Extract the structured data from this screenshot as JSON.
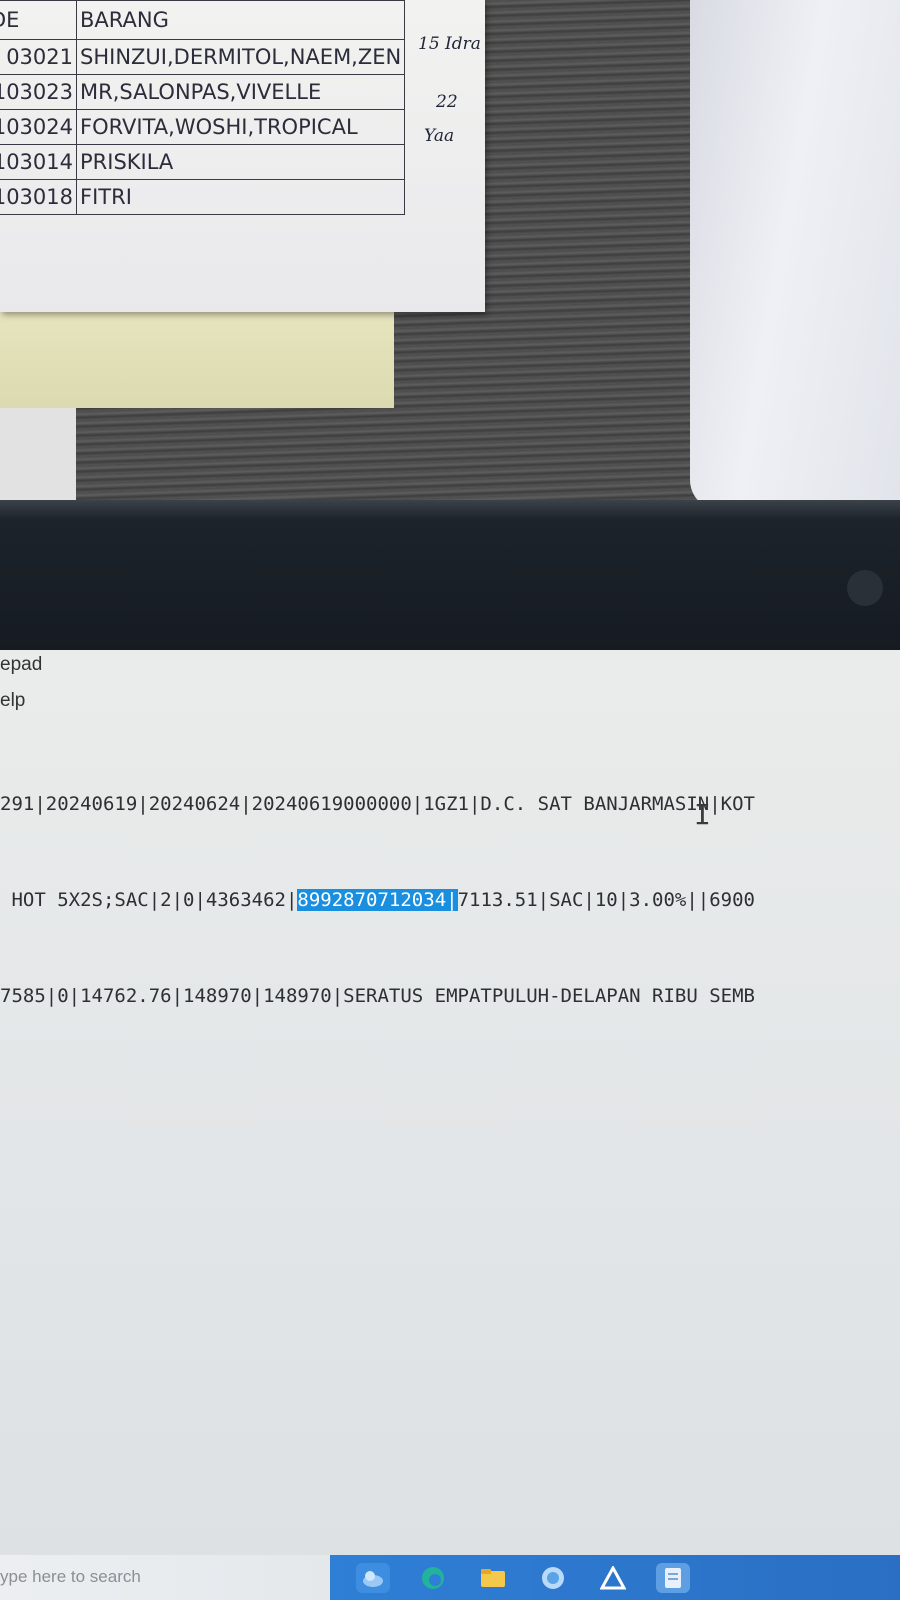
{
  "paper_note": {
    "header": [
      "DE",
      "BARANG"
    ],
    "rows": [
      {
        "code": "03021",
        "items": "SHINZUI,DERMITOL,NAEM,ZEN"
      },
      {
        "code": "103023",
        "items": "MR,SALONPAS,VIVELLE"
      },
      {
        "code": "103024",
        "items": "FORVITA,WOSHI,TROPICAL"
      },
      {
        "code": "103014",
        "items": "PRISKILA"
      },
      {
        "code": "103018",
        "items": "FITRI"
      }
    ],
    "handwriting": [
      "15 Idra",
      "22",
      "Yaa"
    ]
  },
  "notepad": {
    "title": "epad",
    "menu": [
      "elp"
    ],
    "lines": [
      {
        "before": "291|20240619|20240624|20240619000000|1GZ1|D.C. SAT BANJARMASIN|KOT",
        "selected": "",
        "after": ""
      },
      {
        "before": " HOT 5X2S;SAC|2|0|4363462|",
        "selected": "8992870712034|",
        "after": "7113.51|SAC|10|3.00%||6900"
      },
      {
        "before": "7585|0|14762.76|148970|148970|SERATUS EMPATPULUH-DELAPAN RIBU SEMB",
        "selected": "",
        "after": ""
      }
    ],
    "cursor": "I"
  },
  "taskbar": {
    "search_placeholder": "ype here to search",
    "icons": [
      "widgets-icon",
      "edge-icon",
      "file-explorer-icon",
      "chat-icon",
      "autodesk-icon",
      "notepad-icon"
    ]
  },
  "colors": {
    "selection": "#1a8fe0",
    "taskbar": "#2f7fd6"
  }
}
